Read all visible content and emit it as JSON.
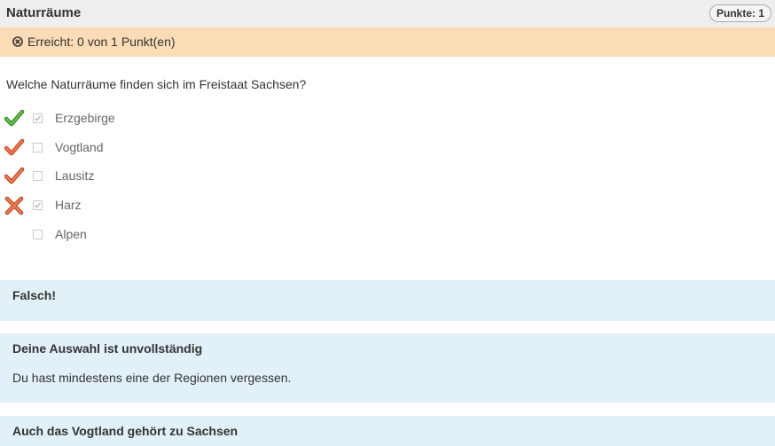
{
  "header": {
    "title": "Naturräume",
    "points_label": "Punkte: 1"
  },
  "result": {
    "icon": "circle-x-icon",
    "text": "Erreicht: 0 von 1 Punkt(en)"
  },
  "question": {
    "text": "Welche Naturräume finden sich im Freistaat Sachsen?"
  },
  "answers": [
    {
      "label": "Erzgebirge",
      "checked": true,
      "mark": "check-green-icon"
    },
    {
      "label": "Vogtland",
      "checked": false,
      "mark": "check-orange-icon"
    },
    {
      "label": "Lausitz",
      "checked": false,
      "mark": "check-orange-icon"
    },
    {
      "label": "Harz",
      "checked": true,
      "mark": "cross-orange-icon"
    },
    {
      "label": "Alpen",
      "checked": false,
      "mark": ""
    }
  ],
  "feedback": [
    {
      "title": "Falsch!",
      "text": ""
    },
    {
      "title": "Deine Auswahl ist unvollständig",
      "text": "Du hast mindestens eine der Regionen vergessen."
    },
    {
      "title": "Auch das Vogtland gehört zu Sachsen",
      "text": ""
    }
  ],
  "colors": {
    "header_bg": "#eeeeee",
    "result_bg": "#fbdcb6",
    "feedback_bg": "#e2f1f7",
    "check_green": "#4cae3d",
    "mark_orange": "#f26a3b"
  }
}
